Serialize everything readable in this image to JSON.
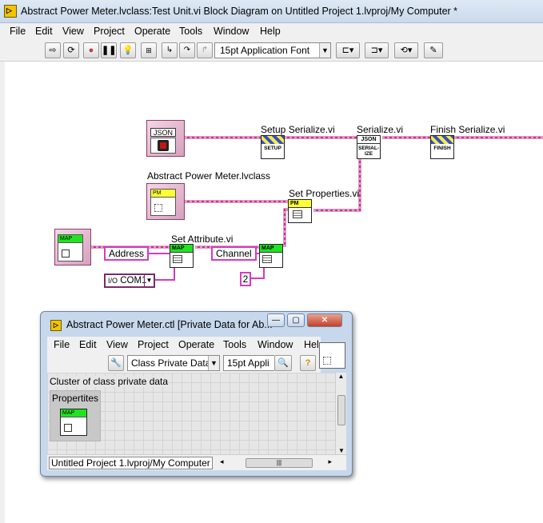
{
  "window": {
    "title": "Abstract Power Meter.lvclass:Test Unit.vi Block Diagram on Untitled Project 1.lvproj/My Computer *"
  },
  "menu": [
    "File",
    "Edit",
    "View",
    "Project",
    "Operate",
    "Tools",
    "Window",
    "Help"
  ],
  "toolbar": {
    "font": "15pt Application Font"
  },
  "diagram": {
    "labels": {
      "setup_serialize": "Setup Serialize.vi",
      "serialize": "Serialize.vi",
      "finish_serialize": "Finish Serialize.vi",
      "class_const": "Abstract Power Meter.lvclass",
      "set_properties": "Set Properties.vi",
      "set_attribute": "Set Attribute.vi"
    },
    "json_header": "JSON",
    "pm_header": "PM",
    "map_header": "MAP",
    "setup_text": "SETUP",
    "serialize_text": "SERIAL-IZE",
    "finish_text": "FINISH",
    "address": "Address",
    "channel": "Channel",
    "com": "COM1",
    "number": "2",
    "wire_color": "#c4348c",
    "accent_yellow": "#ffff33",
    "accent_green": "#22e322"
  },
  "child": {
    "title": "Abstract Power Meter.ctl [Private Data for Ab...",
    "menu": [
      "File",
      "Edit",
      "View",
      "Project",
      "Operate",
      "Tools",
      "Window",
      "Hel"
    ],
    "type_select": "Class Private Data",
    "font_select": "15pt Appli",
    "description": "Cluster of class private data",
    "cluster_label": "Propertites",
    "status_path": "Untitled Project 1.lvproj/My Computer"
  }
}
